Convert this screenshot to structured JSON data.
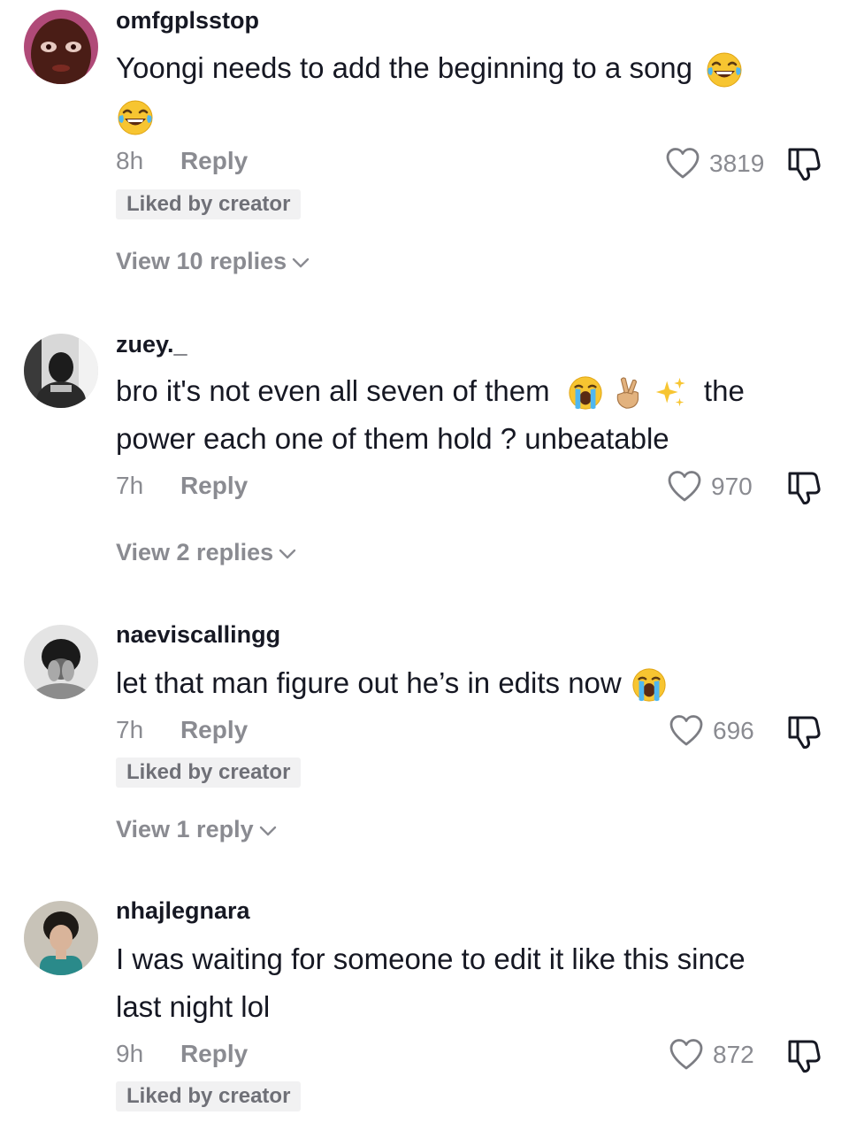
{
  "comments": [
    {
      "username": "omfgplsstop",
      "text": "Yoongi needs to add the beginning to a song",
      "emoji": [
        "grinning-sweat-laugh"
      ],
      "time": "8h",
      "reply_label": "Reply",
      "likes": "3819",
      "liked_by_creator": "Liked by creator",
      "view_replies": "View 10 replies"
    },
    {
      "username": "zuey._",
      "text_line1": "bro it's not even all seven of them",
      "emoji": [
        "loudly-crying-face",
        "crossed-fingers",
        "sparkles"
      ],
      "text_line1_end": "the",
      "text_line2": "power each one of them hold ? unbeatable",
      "time": "7h",
      "reply_label": "Reply",
      "likes": "970",
      "view_replies": "View 2 replies"
    },
    {
      "username": "naeviscallingg",
      "text": "let that man figure out he’s in edits now",
      "emoji": [
        "loudly-crying-face"
      ],
      "time": "7h",
      "reply_label": "Reply",
      "likes": "696",
      "liked_by_creator": "Liked by creator",
      "view_replies": "View 1 reply"
    },
    {
      "username": "nhajlegnara",
      "text_line1": "I was waiting for someone to edit it like this since",
      "text_line2": "last night lol",
      "time": "9h",
      "reply_label": "Reply",
      "likes": "872",
      "liked_by_creator": "Liked by creator"
    }
  ],
  "colors": {
    "primary_text": "#161823",
    "secondary_text": "#8a8b91",
    "badge_bg": "#f1f1f2"
  }
}
